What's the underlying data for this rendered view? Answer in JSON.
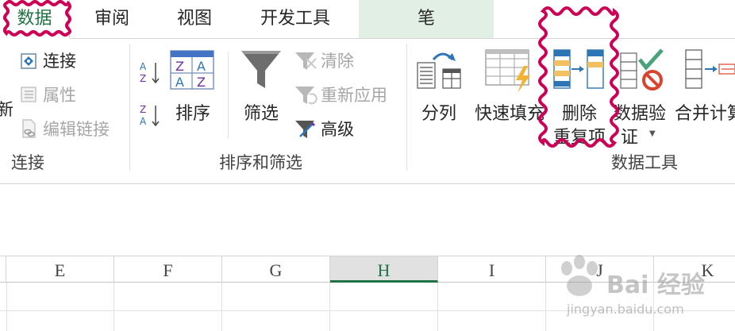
{
  "tabs": {
    "data": "数据",
    "review": "审阅",
    "view": "视图",
    "developer": "开发工具",
    "pen": "笔"
  },
  "ribbon": {
    "connections": {
      "partial_refresh": "新",
      "connect": "连接",
      "properties": "属性",
      "edit_links": "编辑链接",
      "label": "连接"
    },
    "sort_filter": {
      "sort": "排序",
      "filter": "筛选",
      "clear": "清除",
      "reapply": "重新应用",
      "advanced": "高级",
      "label": "排序和筛选"
    },
    "data_tools": {
      "text_to_columns": "分列",
      "flash_fill": "快速填充",
      "remove_duplicates_line1": "删除",
      "remove_duplicates_line2": "重复项",
      "data_validation_line1": "数据验",
      "data_validation_line2": "证",
      "consolidate": "合并计算",
      "label": "数据工具"
    }
  },
  "columns": [
    "E",
    "F",
    "G",
    "H",
    "I",
    "J",
    "K"
  ],
  "active_column": "H",
  "watermark": {
    "text": "Bai 经验",
    "url": "jingyan.baidu.com"
  },
  "colors": {
    "accent": "#217346",
    "annotation": "#cc0055",
    "pen_tab_bg": "#e2efe4"
  }
}
